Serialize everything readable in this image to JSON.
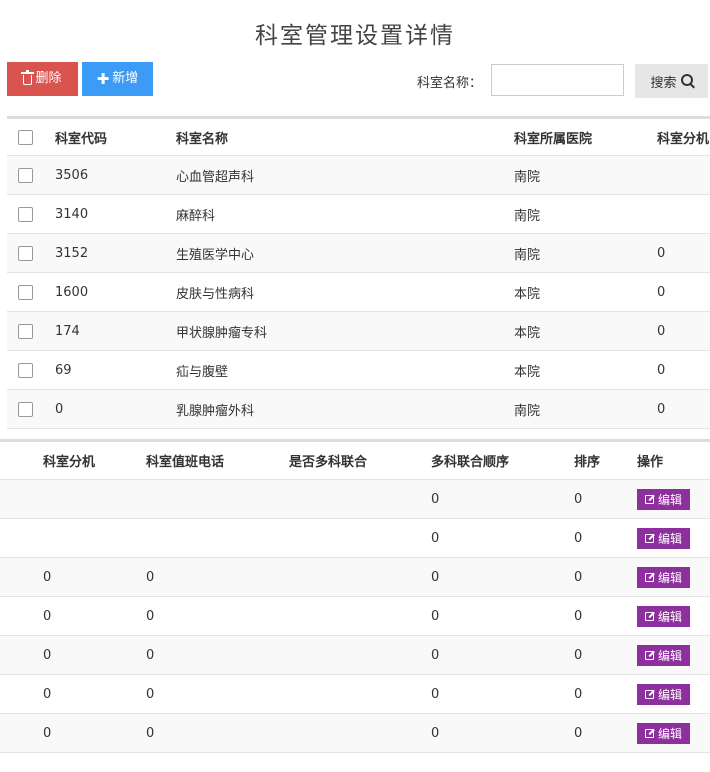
{
  "page": {
    "title": "科室管理设置详情"
  },
  "toolbar": {
    "delete_label": "删除",
    "add_label": "新增",
    "search_label": "科室名称：",
    "search_value": "",
    "search_placeholder": "",
    "search_button_label": "搜索"
  },
  "colors": {
    "delete": "#d9534f",
    "add": "#3c9cf5",
    "edit": "#8e2f9e"
  },
  "table1": {
    "columns": [
      "科室代码",
      "科室名称",
      "科室所属医院",
      "科室分机"
    ],
    "rows": [
      [
        "3506",
        "心血管超声科",
        "南院",
        ""
      ],
      [
        "3140",
        "麻醉科",
        "南院",
        ""
      ],
      [
        "3152",
        "生殖医学中心",
        "南院",
        "0"
      ],
      [
        "1600",
        "皮肤与性病科",
        "本院",
        "0"
      ],
      [
        "174",
        "甲状腺肿瘤专科",
        "本院",
        "0"
      ],
      [
        "69",
        "疝与腹壁",
        "本院",
        "0"
      ],
      [
        "0",
        "乳腺肿瘤外科",
        "南院",
        "0"
      ]
    ]
  },
  "table2": {
    "columns": [
      "科室分机",
      "科室值班电话",
      "是否多科联合",
      "多科联合顺序",
      "排序",
      "操作"
    ],
    "edit_label": "编辑",
    "rows": [
      [
        "",
        "",
        "",
        "0",
        "0"
      ],
      [
        "",
        "",
        "",
        "0",
        "0"
      ],
      [
        "0",
        "0",
        "",
        "0",
        "0"
      ],
      [
        "0",
        "0",
        "",
        "0",
        "0"
      ],
      [
        "0",
        "0",
        "",
        "0",
        "0"
      ],
      [
        "0",
        "0",
        "",
        "0",
        "0"
      ],
      [
        "0",
        "0",
        "",
        "0",
        "0"
      ]
    ]
  }
}
